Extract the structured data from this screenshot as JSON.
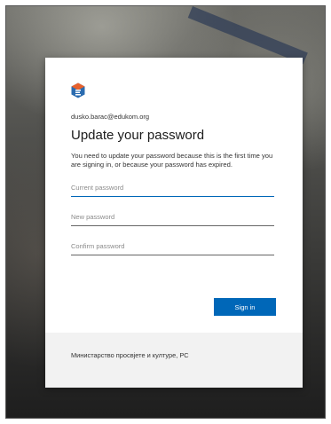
{
  "account": {
    "email": "dusko.barac@edukom.org"
  },
  "page": {
    "title": "Update your password",
    "description": "You need to update your password because this is the first time you are signing in, or because your password has expired."
  },
  "form": {
    "current_password": {
      "placeholder": "Current password",
      "value": ""
    },
    "new_password": {
      "placeholder": "New password",
      "value": ""
    },
    "confirm_password": {
      "placeholder": "Confirm password",
      "value": ""
    },
    "submit_label": "Sign in"
  },
  "footer": {
    "text": "Министарство просвјете и културе, РС"
  },
  "colors": {
    "accent": "#0067b8",
    "logo_orange": "#e8612c",
    "logo_blue": "#2b6cb0"
  },
  "icons": {
    "logo": "organization-logo-icon"
  }
}
